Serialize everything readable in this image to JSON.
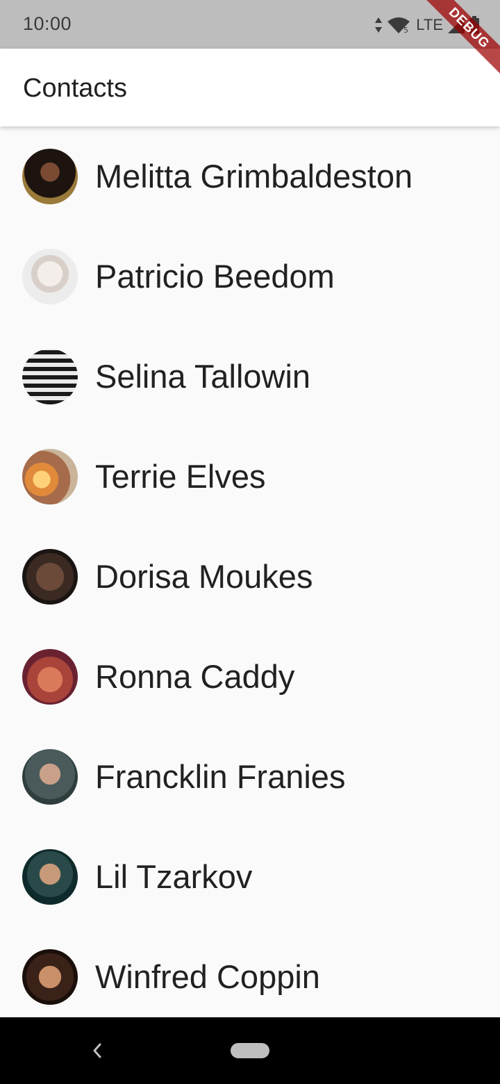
{
  "status_bar": {
    "time": "10:00",
    "network_label": "LTE",
    "wifi_badge": "5",
    "icons": [
      "data-arrows-icon",
      "wifi-icon",
      "signal-icon",
      "battery-icon"
    ]
  },
  "debug_banner": {
    "label": "DEBUG"
  },
  "app_bar": {
    "title": "Contacts"
  },
  "contacts": [
    {
      "name": "Melitta Grimbaldeston"
    },
    {
      "name": "Patricio Beedom"
    },
    {
      "name": "Selina Tallowin"
    },
    {
      "name": "Terrie Elves"
    },
    {
      "name": "Dorisa Moukes"
    },
    {
      "name": "Ronna Caddy"
    },
    {
      "name": "Francklin Franies"
    },
    {
      "name": "Lil Tzarkov"
    },
    {
      "name": "Winfred Coppin"
    }
  ],
  "nav_bar": {
    "icons": [
      "back-icon",
      "home-pill-icon"
    ]
  },
  "colors": {
    "status_bar_bg": "#bdbdbd",
    "app_bar_bg": "#ffffff",
    "list_bg": "#fafafa",
    "nav_bar_bg": "#000000",
    "debug_ribbon": "#a00000"
  }
}
